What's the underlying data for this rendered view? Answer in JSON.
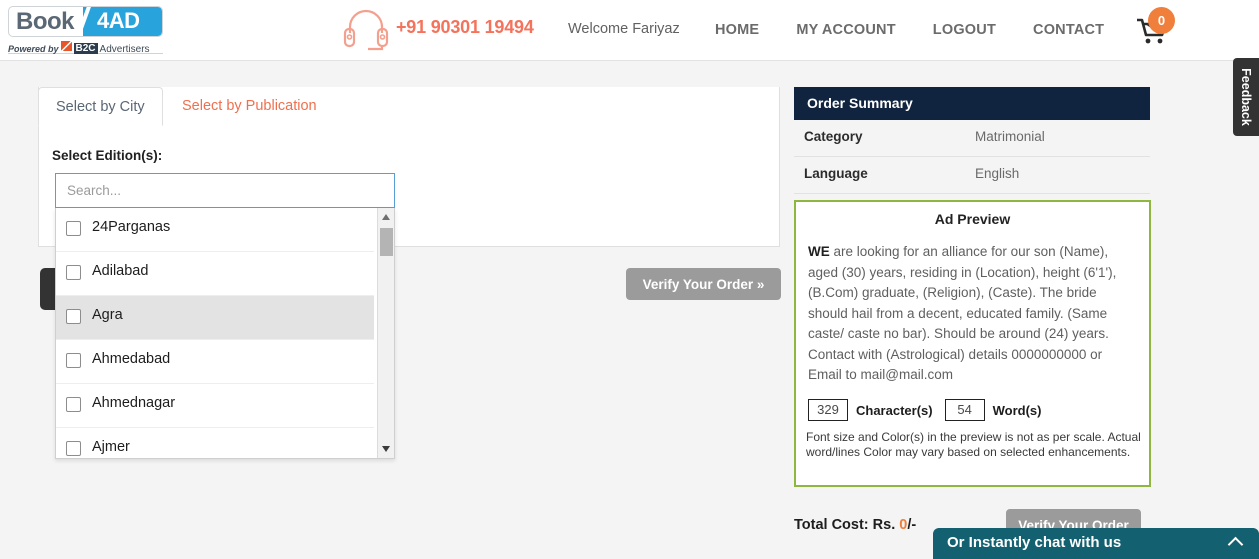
{
  "header": {
    "logo": {
      "book_text": "Book",
      "ad_text": "4AD",
      "powered_by": "Powered by",
      "b2c": "B2C",
      "advertisers": "Advertisers"
    },
    "headset_icon": "headset-icon",
    "phone": "+91 90301 19494",
    "welcome": "Welcome Fariyaz",
    "nav": [
      {
        "label": "HOME"
      },
      {
        "label": "MY ACCOUNT"
      },
      {
        "label": "LOGOUT"
      },
      {
        "label": "CONTACT"
      }
    ],
    "cart_icon": "cart-icon",
    "cart_count": "0",
    "colors": {
      "phone": "#f4735c",
      "cart_badge": "#f07f3c",
      "logo_blue": "#29a3dc"
    }
  },
  "feedback_tab": {
    "label": "Feedback"
  },
  "left_panel": {
    "tabs": [
      {
        "label": "Select by City",
        "active": true
      },
      {
        "label": "Select by Publication",
        "active": false
      }
    ],
    "edition_label": "Select Edition(s):",
    "search": {
      "placeholder": "Search...",
      "value": ""
    },
    "dropdown": {
      "items": [
        {
          "label": "24Parganas",
          "checked": false,
          "highlighted": false
        },
        {
          "label": "Adilabad",
          "checked": false,
          "highlighted": false
        },
        {
          "label": "Agra",
          "checked": false,
          "highlighted": true
        },
        {
          "label": "Ahmedabad",
          "checked": false,
          "highlighted": false
        },
        {
          "label": "Ahmednagar",
          "checked": false,
          "highlighted": false
        },
        {
          "label": "Ajmer",
          "checked": false,
          "highlighted": false
        }
      ],
      "scroll_up_icon": "scroll-up-arrow-icon",
      "scroll_down_icon": "scroll-down-arrow-icon"
    },
    "verify_button": "Verify Your Order »"
  },
  "order_summary": {
    "title": "Order Summary",
    "rows": [
      {
        "key": "Category",
        "value": "Matrimonial"
      },
      {
        "key": "Language",
        "value": "English"
      }
    ],
    "header_color": "#10243f"
  },
  "ad_preview": {
    "title": "Ad Preview",
    "lead": "WE",
    "text": " are looking for an alliance for our son (Name), aged (30) years, residing in (Location), height (6'1'), (B.Com) graduate, (Religion), (Caste). The bride should hail from a decent, educated family. (Same caste/ caste no bar). Should be around (24) years. Contact with (Astrological) details 0000000000 or Email to mail@mail.com",
    "char_count": "329",
    "char_label": "Character(s)",
    "word_count": "54",
    "word_label": "Word(s)",
    "note": "Font size and Color(s) in the preview is not as per scale. Actual word/lines Color may vary based on selected enhancements.",
    "border_color": "#8fb63e"
  },
  "footer": {
    "total_label": "Total Cost: Rs. ",
    "total_amount": "0",
    "total_suffix": "/-",
    "verify_button": "Verify Your Order"
  },
  "chat": {
    "label": "Or Instantly chat with us",
    "chevron_icon": "chevron-up-icon",
    "color": "#136070"
  }
}
